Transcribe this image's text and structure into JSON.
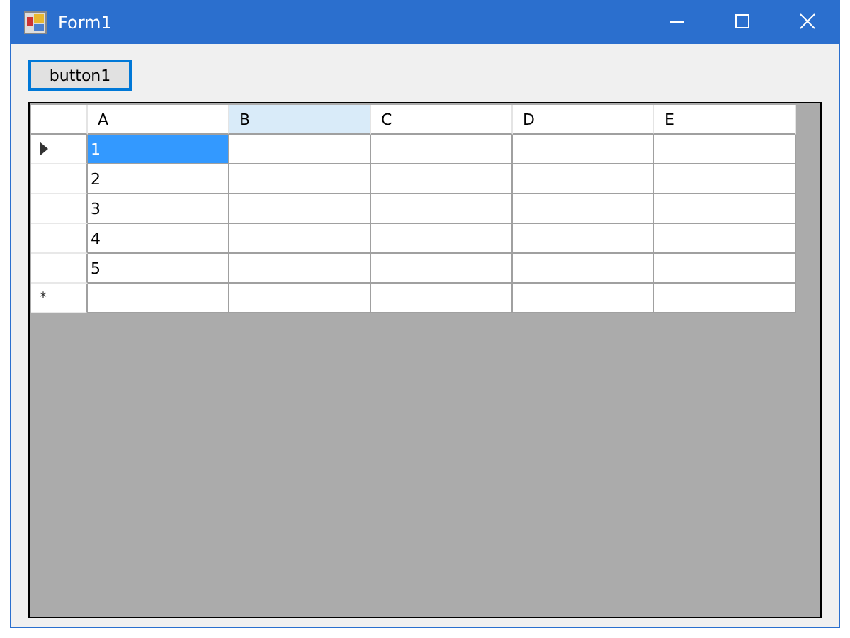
{
  "window": {
    "title": "Form1"
  },
  "button": {
    "label": "button1",
    "focused": true
  },
  "grid": {
    "columns": [
      {
        "label": "A",
        "hovered": false
      },
      {
        "label": "B",
        "hovered": true
      },
      {
        "label": "C",
        "hovered": false
      },
      {
        "label": "D",
        "hovered": false
      },
      {
        "label": "E",
        "hovered": false
      }
    ],
    "rows": [
      {
        "current": true,
        "cells": [
          {
            "text": "1",
            "selected": true
          },
          {
            "selected": false
          },
          {
            "selected": false
          },
          {
            "selected": false
          },
          {
            "selected": false
          }
        ]
      },
      {
        "current": false,
        "cells": [
          {
            "text": "2",
            "selected": false
          },
          {
            "selected": false
          },
          {
            "selected": false
          },
          {
            "selected": false
          },
          {
            "selected": false
          }
        ]
      },
      {
        "current": false,
        "cells": [
          {
            "text": "3",
            "selected": false
          },
          {
            "selected": false
          },
          {
            "selected": false
          },
          {
            "selected": false
          },
          {
            "selected": false
          }
        ]
      },
      {
        "current": false,
        "cells": [
          {
            "text": "4",
            "selected": false
          },
          {
            "selected": false
          },
          {
            "selected": false
          },
          {
            "selected": false
          },
          {
            "selected": false
          }
        ]
      },
      {
        "current": false,
        "cells": [
          {
            "text": "5",
            "selected": false
          },
          {
            "selected": false
          },
          {
            "selected": false
          },
          {
            "selected": false
          },
          {
            "selected": false
          }
        ]
      }
    ],
    "new_row": {
      "marker": "*"
    }
  }
}
